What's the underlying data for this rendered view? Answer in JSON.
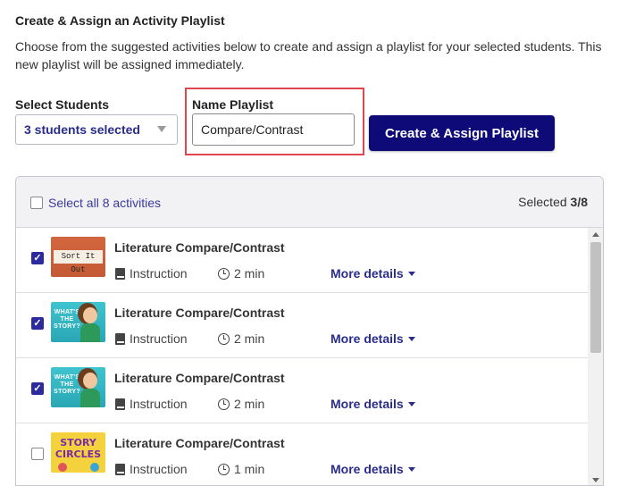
{
  "header": {
    "title": "Create & Assign an Activity Playlist",
    "description": "Choose from the suggested activities below to create and assign a playlist for your selected students. This new playlist will be assigned immediately."
  },
  "students": {
    "label": "Select Students",
    "value": "3 students selected"
  },
  "playlist": {
    "label": "Name Playlist",
    "value": "Compare/Contrast"
  },
  "create_button": "Create & Assign Playlist",
  "activities": {
    "select_all_label": "Select all 8 activities",
    "selected_prefix": "Selected ",
    "selected_count": "3/8",
    "more_details_label": "More details",
    "items": [
      {
        "title": "Literature Compare/Contrast",
        "type": "Instruction",
        "duration": "2 min",
        "checked": true,
        "thumbnail": "sort-it-out",
        "thumbnail_text": "Sort It Out"
      },
      {
        "title": "Literature Compare/Contrast",
        "type": "Instruction",
        "duration": "2 min",
        "checked": true,
        "thumbnail": "whats-the-story",
        "thumbnail_text": "WHAT'S THE STORY?"
      },
      {
        "title": "Literature Compare/Contrast",
        "type": "Instruction",
        "duration": "2 min",
        "checked": true,
        "thumbnail": "whats-the-story",
        "thumbnail_text": "WHAT'S THE STORY?"
      },
      {
        "title": "Literature Compare/Contrast",
        "type": "Instruction",
        "duration": "1 min",
        "checked": false,
        "thumbnail": "story-circles",
        "thumbnail_text": "STORY CIRCLES"
      }
    ]
  },
  "icons": {
    "type_icon": "book-icon",
    "duration_icon": "clock-icon",
    "dropdown_icon": "caret-down-icon"
  },
  "colors": {
    "primary": "#0e0a78",
    "link": "#2a2c8e",
    "highlight": "#e0464d",
    "checkbox_checked": "#2d2a9e"
  }
}
